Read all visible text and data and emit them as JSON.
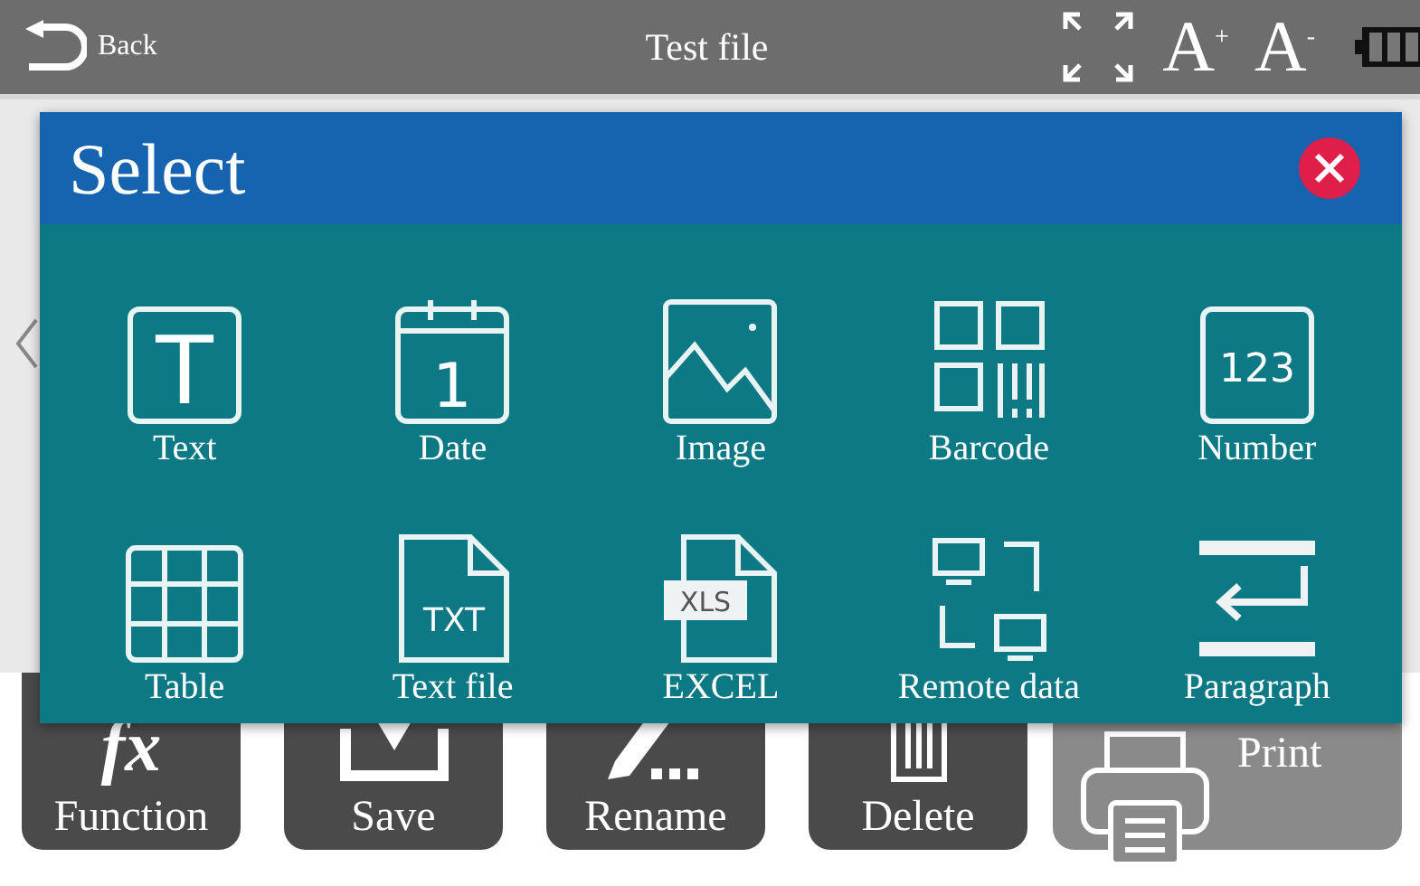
{
  "top_bar": {
    "back": "Back",
    "title": "Test file",
    "font_larger": "A$^{+}$",
    "font_smaller": "A$^{-}$"
  },
  "dialog": {
    "title": "Select",
    "items": [
      {
        "kind": "text",
        "label": "Text",
        "glyph": "T"
      },
      {
        "kind": "date",
        "label": "Date",
        "glyph": "1"
      },
      {
        "kind": "image",
        "label": "Image"
      },
      {
        "kind": "barcode",
        "label": "Barcode"
      },
      {
        "kind": "number",
        "label": "Number",
        "glyph": "123"
      },
      {
        "kind": "table",
        "label": "Table"
      },
      {
        "kind": "textfile",
        "label": "Text file",
        "glyph": "TXT"
      },
      {
        "kind": "excel",
        "label": "EXCEL",
        "glyph": "XLS"
      },
      {
        "kind": "remote",
        "label": "Remote data"
      },
      {
        "kind": "paragraph",
        "label": "Paragraph"
      }
    ]
  },
  "buttons": [
    {
      "kind": "function",
      "label": "Function",
      "glyph": "fx"
    },
    {
      "kind": "save",
      "label": "Save"
    },
    {
      "kind": "rename",
      "label": "Rename"
    },
    {
      "kind": "delete",
      "label": "Delete"
    },
    {
      "kind": "print",
      "label": "Print"
    }
  ]
}
